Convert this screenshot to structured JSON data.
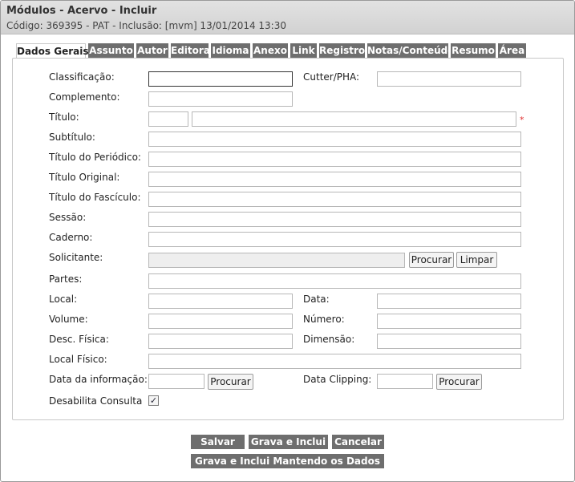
{
  "header": {
    "title": "Módulos - Acervo - Incluir",
    "subtitle": "Código: 369395 - PAT - Inclusão: [mvm] 13/01/2014 13:30"
  },
  "tabs": [
    "Dados Gerais",
    "Assunto",
    "Autor",
    "Editora",
    "Idioma",
    "Anexo",
    "Link",
    "Registro",
    "Notas/Conteúdo",
    "Resumo",
    "Área"
  ],
  "active_tab": "Dados Gerais",
  "form": {
    "classificacao": "Classificação:",
    "cutter": "Cutter/PHA:",
    "complemento": "Complemento:",
    "titulo": "Título:",
    "subtitulo": "Subtítulo:",
    "titulo_periodico": "Título do Periódico:",
    "titulo_original": "Título Original:",
    "titulo_fasciculo": "Título do Fascículo:",
    "sessao": "Sessão:",
    "caderno": "Caderno:",
    "solicitante": "Solicitante:",
    "partes": "Partes:",
    "local": "Local:",
    "data": "Data:",
    "volume": "Volume:",
    "numero": "Número:",
    "desc_fisica": "Desc. Física:",
    "dimensao": "Dimensão:",
    "local_fisico": "Local Físico:",
    "data_informacao": "Data da informação:",
    "data_clipping": "Data Clipping:",
    "desabilita_consulta": "Desabilita Consulta",
    "desabilita_checked": "✓",
    "required_mark": "*"
  },
  "buttons": {
    "procurar": "Procurar",
    "limpar": "Limpar"
  },
  "actions": {
    "salvar": "Salvar",
    "grava_inclui": "Grava e Inclui",
    "cancelar": "Cancelar",
    "grava_inclui_mantendo": "Grava e Inclui Mantendo os Dados"
  },
  "colors": {
    "tab_bg": "#6e6e6e",
    "header_bg": "#d8d8d8",
    "required": "#e03030"
  }
}
